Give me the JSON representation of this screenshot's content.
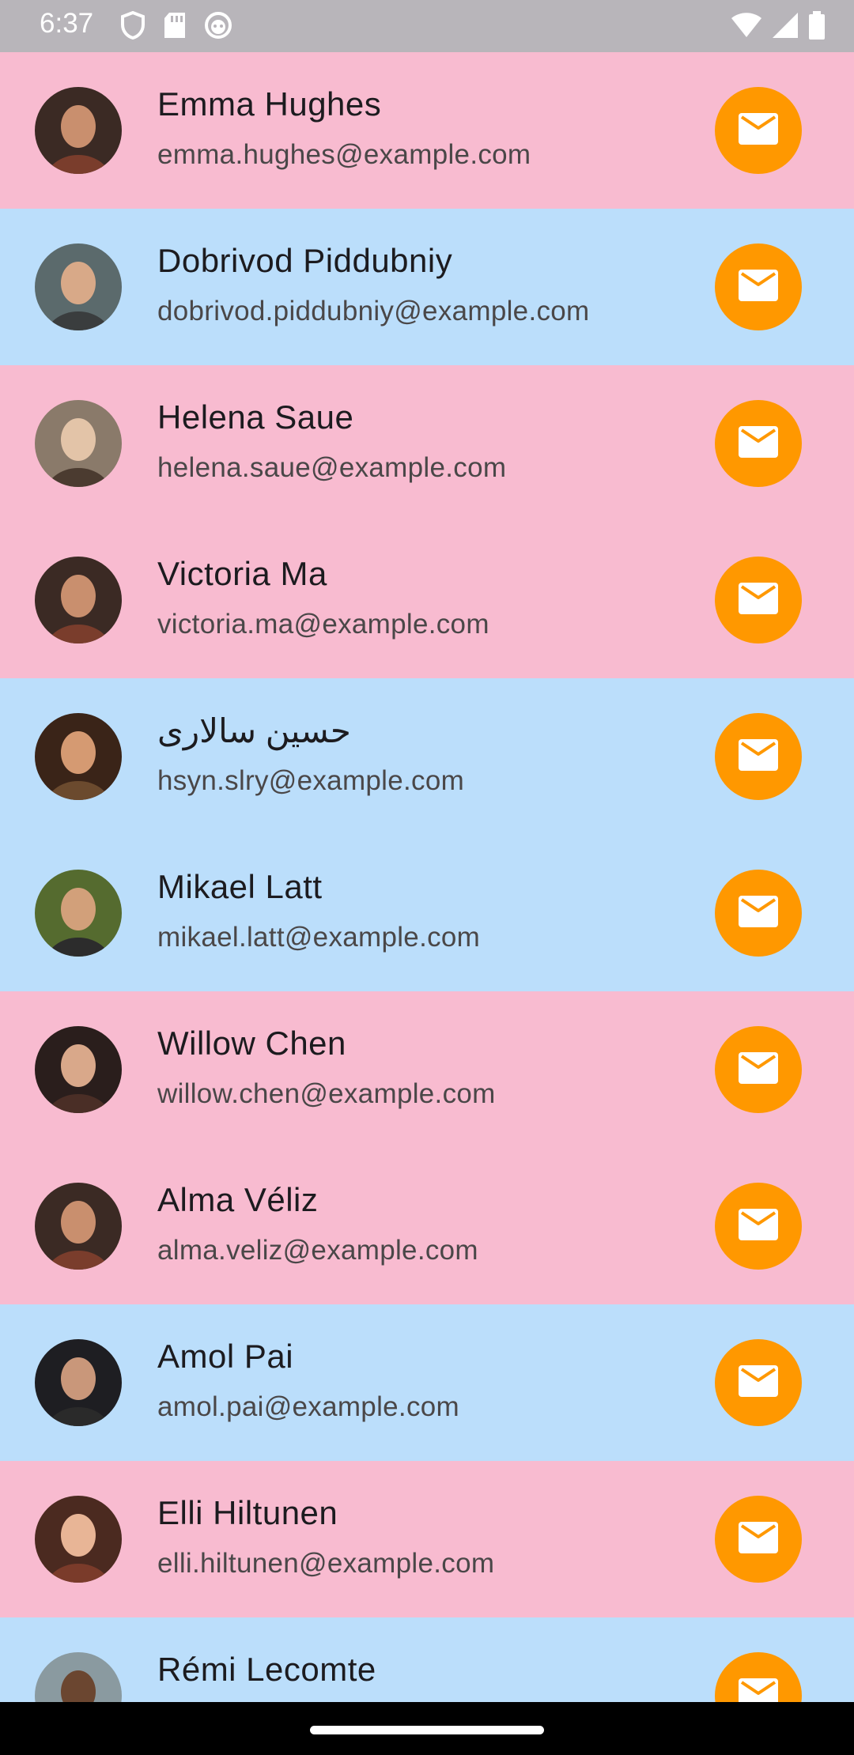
{
  "status_bar": {
    "time": "6:37",
    "left_icons": [
      "shield-icon",
      "sd-card-icon",
      "face-icon"
    ],
    "right_icons": [
      "wifi-icon",
      "cellular-signal-icon",
      "battery-icon"
    ]
  },
  "colors": {
    "pink_row": "#f8bbd0",
    "blue_row": "#bbdefb",
    "mail_button": "#ff9800",
    "status_bar": "#b8b5ba"
  },
  "contacts": [
    {
      "name": "Emma Hughes",
      "email": "emma.hughes@example.com",
      "row_color": "pink",
      "icon": "mail-icon"
    },
    {
      "name": "Dobrivod Piddubniy",
      "email": "dobrivod.piddubniy@example.com",
      "row_color": "blue",
      "icon": "mail-icon"
    },
    {
      "name": "Helena Saue",
      "email": "helena.saue@example.com",
      "row_color": "pink",
      "icon": "mail-icon"
    },
    {
      "name": "Victoria Ma",
      "email": "victoria.ma@example.com",
      "row_color": "pink",
      "icon": "mail-icon"
    },
    {
      "name": "حسین سالاری",
      "email": "hsyn.slry@example.com",
      "row_color": "blue",
      "icon": "mail-icon"
    },
    {
      "name": "Mikael Latt",
      "email": "mikael.latt@example.com",
      "row_color": "blue",
      "icon": "mail-icon"
    },
    {
      "name": "Willow Chen",
      "email": "willow.chen@example.com",
      "row_color": "pink",
      "icon": "mail-icon"
    },
    {
      "name": "Alma Véliz",
      "email": "alma.veliz@example.com",
      "row_color": "pink",
      "icon": "mail-icon"
    },
    {
      "name": "Amol Pai",
      "email": "amol.pai@example.com",
      "row_color": "blue",
      "icon": "mail-icon"
    },
    {
      "name": "Elli Hiltunen",
      "email": "elli.hiltunen@example.com",
      "row_color": "pink",
      "icon": "mail-icon"
    },
    {
      "name": "Rémi Lecomte",
      "email": "",
      "row_color": "blue",
      "icon": "mail-icon"
    }
  ]
}
